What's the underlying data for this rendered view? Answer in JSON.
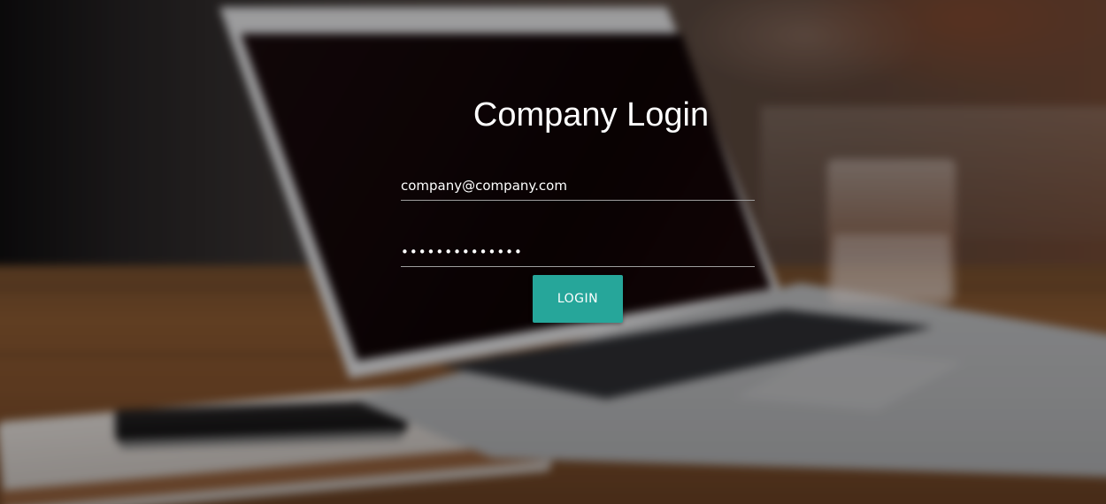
{
  "login": {
    "title": "Company Login",
    "email_value": "company@company.com",
    "password_value": "••••••••••••••",
    "button_label": "LOGIN"
  },
  "colors": {
    "accent": "#26a69a",
    "text": "#ffffff",
    "underline": "#9e9e9e"
  }
}
